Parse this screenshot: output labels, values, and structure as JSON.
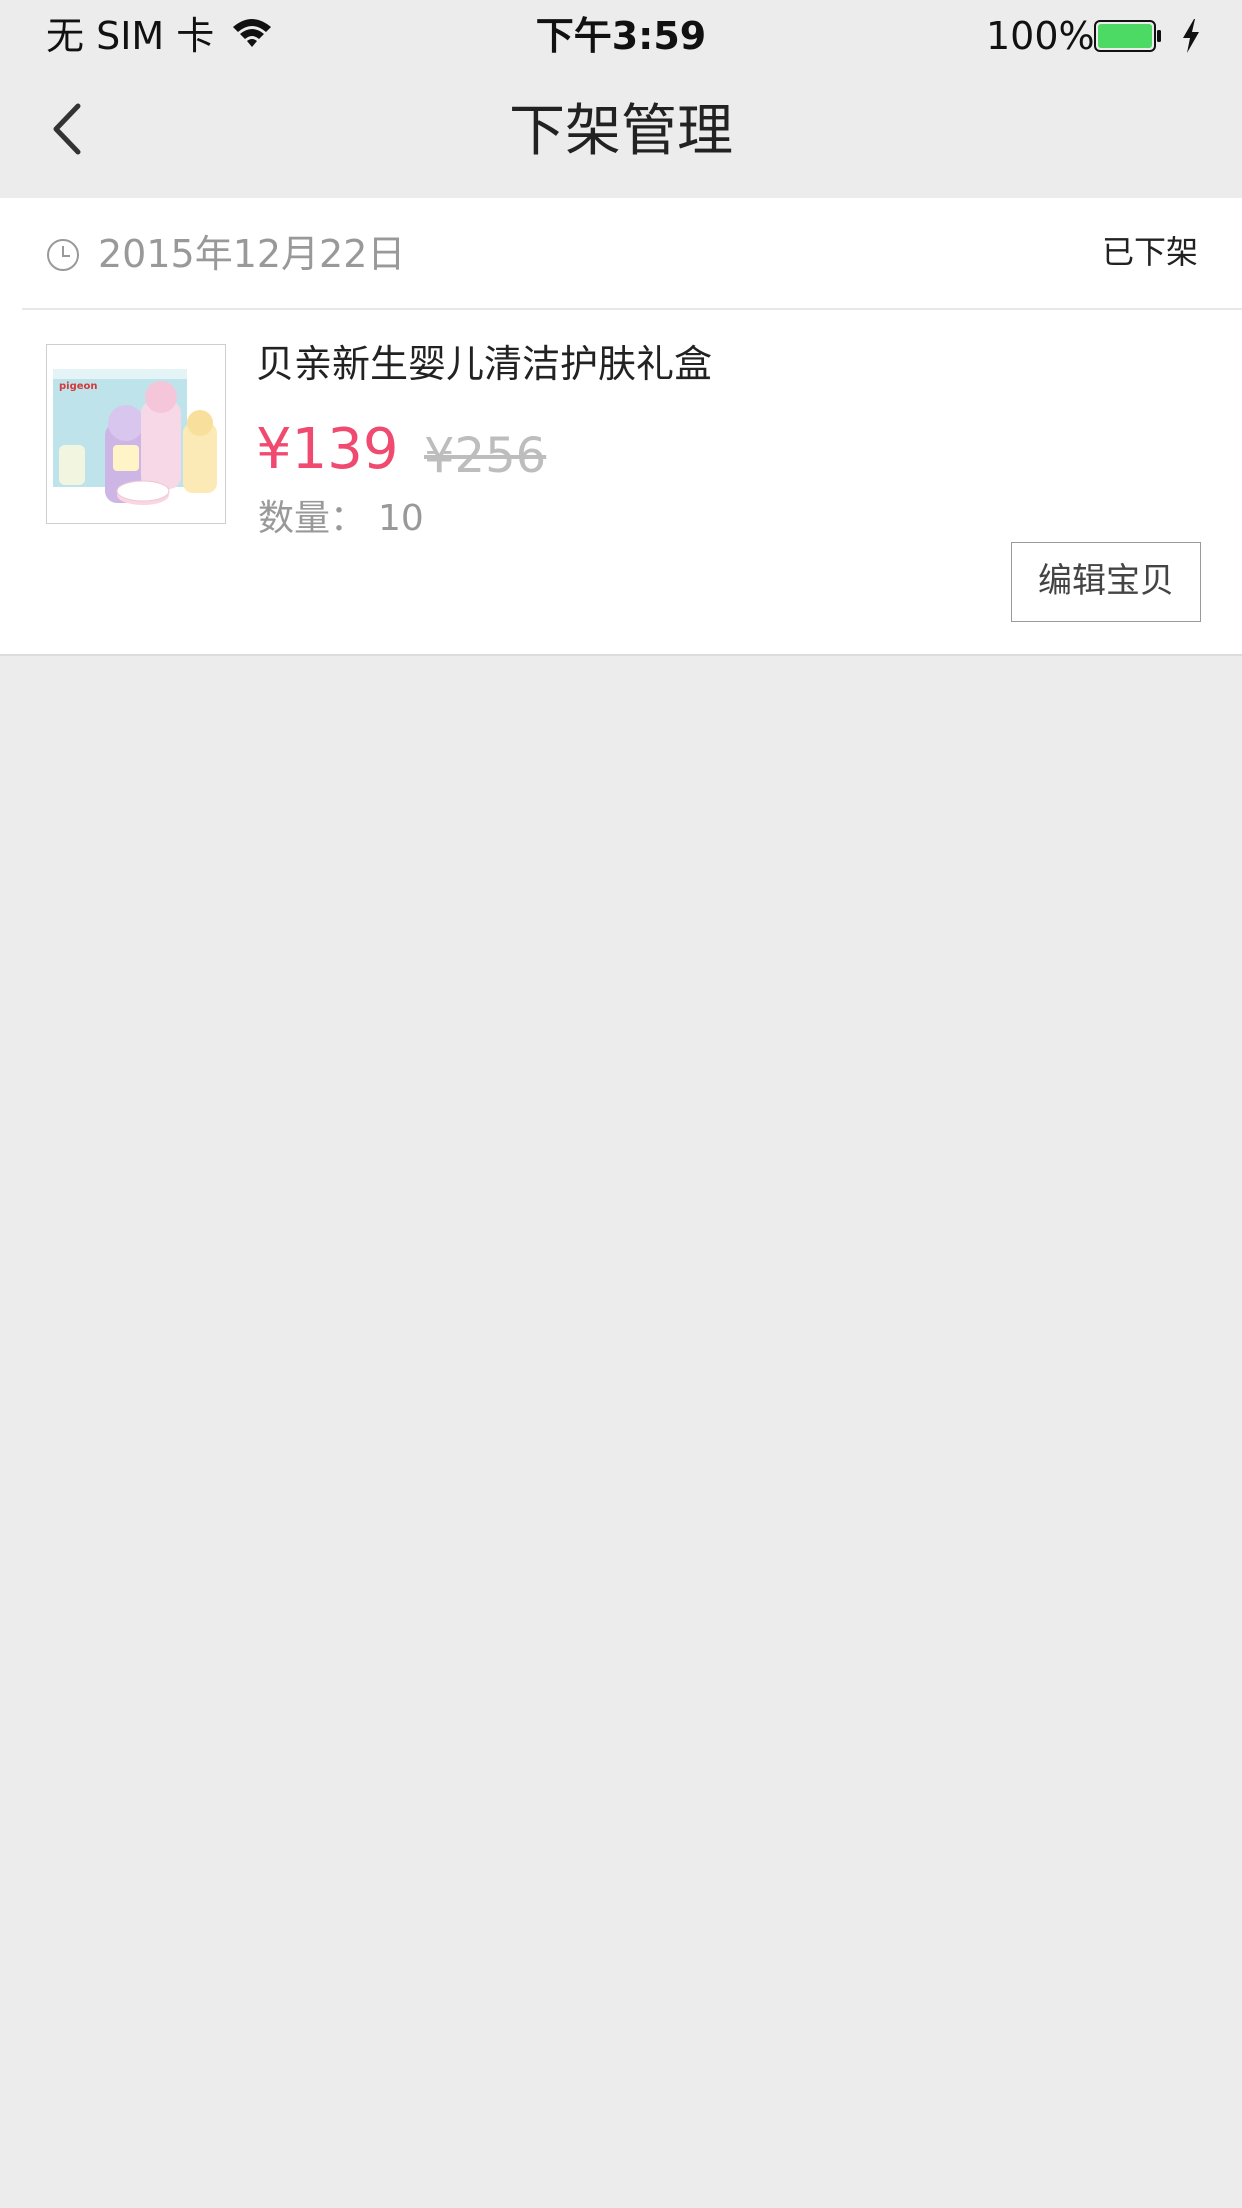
{
  "status_bar": {
    "carrier": "无 SIM 卡",
    "time": "下午3:59",
    "battery_percent": "100%",
    "battery_level": 1.0,
    "battery_color": "#4cd964",
    "wifi_icon": "wifi-icon",
    "charging_icon": "bolt-icon"
  },
  "nav": {
    "back_icon": "chevron-left-icon",
    "title": "下架管理"
  },
  "order": {
    "date_icon": "clock-icon",
    "date": "2015年12月22日",
    "status": "已下架",
    "product": {
      "name": "贝亲新生婴儿清洁护肤礼盒",
      "price": "¥139",
      "original_price": "¥256",
      "quantity_label": "数量：",
      "quantity": "10",
      "thumbnail_brand": "pigeon"
    },
    "edit_button": "编辑宝贝"
  },
  "colors": {
    "accent_price": "#f04a70",
    "background": "#ececec"
  }
}
